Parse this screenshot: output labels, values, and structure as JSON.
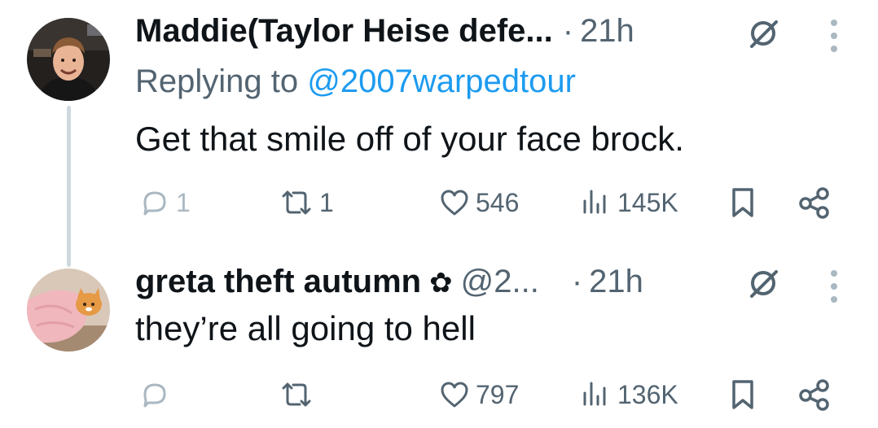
{
  "tweets": [
    {
      "author_name": "Maddie(Taylor Heise defe...",
      "separator": "·",
      "time": "21h",
      "replying_label": "Replying to",
      "replying_handle": "@2007warpedtour",
      "text": "Get that smile off of your face brock.",
      "replies": "1",
      "reposts": "1",
      "likes": "546",
      "views": "145K",
      "icons": [
        "no-edit-icon",
        "more-icon",
        "reply-icon",
        "repost-icon",
        "like-icon",
        "views-icon",
        "bookmark-icon",
        "share-icon"
      ]
    },
    {
      "author_name": "greta theft autumn",
      "flower": "✿",
      "handle": "@2...",
      "separator": "·",
      "time": "21h",
      "text": "they’re all going to hell",
      "replies": "",
      "reposts": "",
      "likes": "797",
      "views": "136K",
      "icons": [
        "no-edit-icon",
        "more-icon",
        "reply-icon",
        "repost-icon",
        "like-icon",
        "views-icon",
        "bookmark-icon",
        "share-icon"
      ]
    }
  ],
  "colors": {
    "text": "#0f1419",
    "secondary": "#536471",
    "link": "#1d9bf0",
    "thread_line": "#cfd9de"
  }
}
